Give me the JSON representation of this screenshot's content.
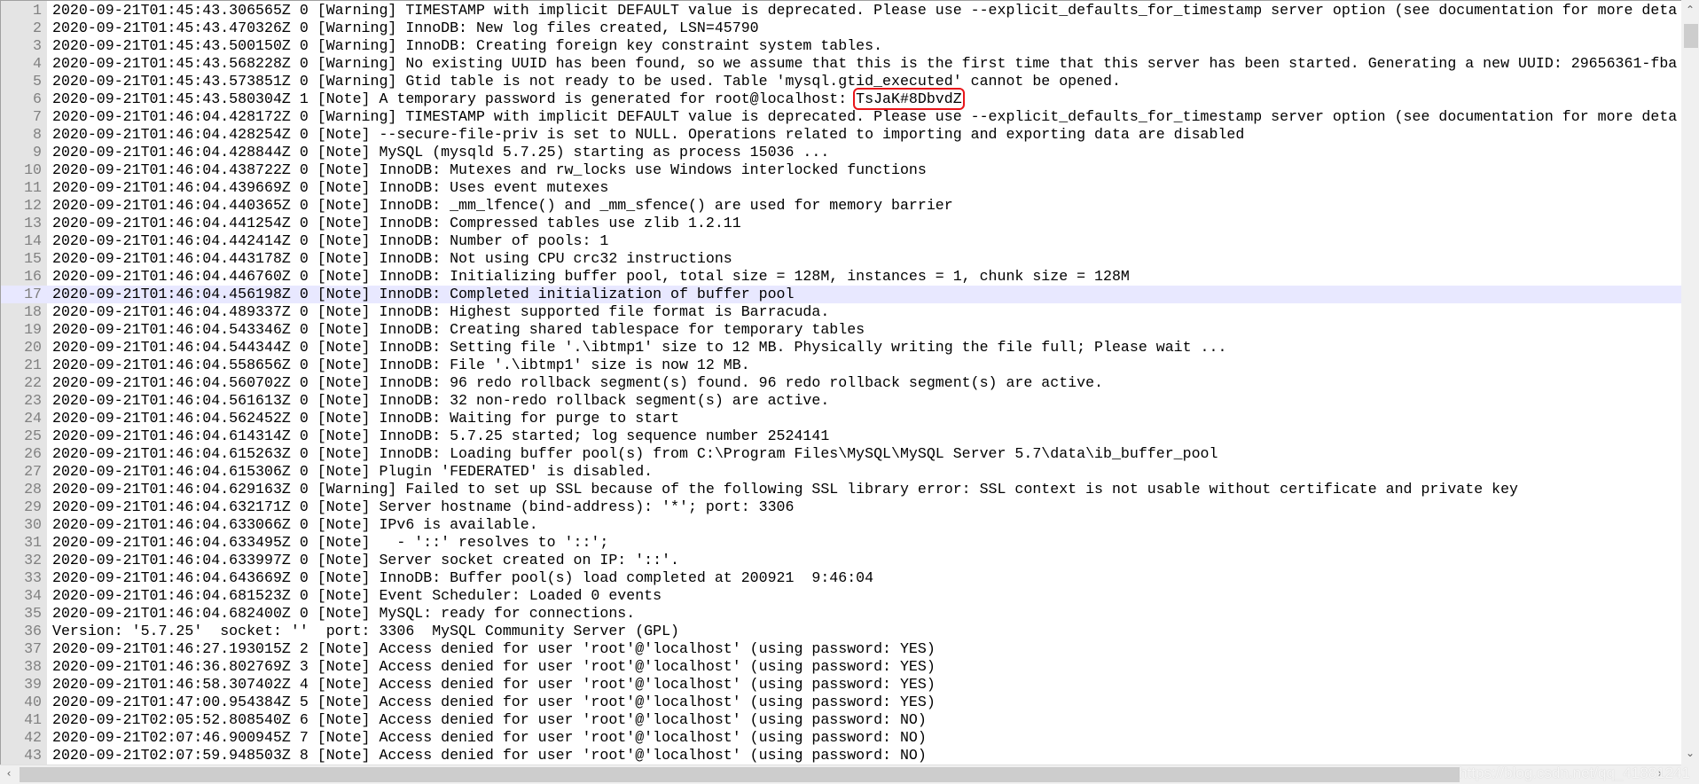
{
  "editor": {
    "current_line": 17,
    "password_line": 6,
    "password": "TsJaK#8DbvdZ",
    "highlight_color": "#e8151a",
    "lines": [
      "2020-09-21T01:45:43.306565Z 0 [Warning] TIMESTAMP with implicit DEFAULT value is deprecated. Please use --explicit_defaults_for_timestamp server option (see documentation for more deta",
      "2020-09-21T01:45:43.470326Z 0 [Warning] InnoDB: New log files created, LSN=45790",
      "2020-09-21T01:45:43.500150Z 0 [Warning] InnoDB: Creating foreign key constraint system tables.",
      "2020-09-21T01:45:43.568228Z 0 [Warning] No existing UUID has been found, so we assume that this is the first time that this server has been started. Generating a new UUID: 29656361-fba",
      "2020-09-21T01:45:43.573851Z 0 [Warning] Gtid table is not ready to be used. Table 'mysql.gtid_executed' cannot be opened.",
      "2020-09-21T01:45:43.580304Z 1 [Note] A temporary password is generated for root@localhost: ",
      "2020-09-21T01:46:04.428172Z 0 [Warning] TIMESTAMP with implicit DEFAULT value is deprecated. Please use --explicit_defaults_for_timestamp server option (see documentation for more deta",
      "2020-09-21T01:46:04.428254Z 0 [Note] --secure-file-priv is set to NULL. Operations related to importing and exporting data are disabled",
      "2020-09-21T01:46:04.428844Z 0 [Note] MySQL (mysqld 5.7.25) starting as process 15036 ...",
      "2020-09-21T01:46:04.438722Z 0 [Note] InnoDB: Mutexes and rw_locks use Windows interlocked functions",
      "2020-09-21T01:46:04.439669Z 0 [Note] InnoDB: Uses event mutexes",
      "2020-09-21T01:46:04.440365Z 0 [Note] InnoDB: _mm_lfence() and _mm_sfence() are used for memory barrier",
      "2020-09-21T01:46:04.441254Z 0 [Note] InnoDB: Compressed tables use zlib 1.2.11",
      "2020-09-21T01:46:04.442414Z 0 [Note] InnoDB: Number of pools: 1",
      "2020-09-21T01:46:04.443178Z 0 [Note] InnoDB: Not using CPU crc32 instructions",
      "2020-09-21T01:46:04.446760Z 0 [Note] InnoDB: Initializing buffer pool, total size = 128M, instances = 1, chunk size = 128M",
      "2020-09-21T01:46:04.456198Z 0 [Note] InnoDB: Completed initialization of buffer pool",
      "2020-09-21T01:46:04.489337Z 0 [Note] InnoDB: Highest supported file format is Barracuda.",
      "2020-09-21T01:46:04.543346Z 0 [Note] InnoDB: Creating shared tablespace for temporary tables",
      "2020-09-21T01:46:04.544344Z 0 [Note] InnoDB: Setting file '.\\ibtmp1' size to 12 MB. Physically writing the file full; Please wait ...",
      "2020-09-21T01:46:04.558656Z 0 [Note] InnoDB: File '.\\ibtmp1' size is now 12 MB.",
      "2020-09-21T01:46:04.560702Z 0 [Note] InnoDB: 96 redo rollback segment(s) found. 96 redo rollback segment(s) are active.",
      "2020-09-21T01:46:04.561613Z 0 [Note] InnoDB: 32 non-redo rollback segment(s) are active.",
      "2020-09-21T01:46:04.562452Z 0 [Note] InnoDB: Waiting for purge to start",
      "2020-09-21T01:46:04.614314Z 0 [Note] InnoDB: 5.7.25 started; log sequence number 2524141",
      "2020-09-21T01:46:04.615263Z 0 [Note] InnoDB: Loading buffer pool(s) from C:\\Program Files\\MySQL\\MySQL Server 5.7\\data\\ib_buffer_pool",
      "2020-09-21T01:46:04.615306Z 0 [Note] Plugin 'FEDERATED' is disabled.",
      "2020-09-21T01:46:04.629163Z 0 [Warning] Failed to set up SSL because of the following SSL library error: SSL context is not usable without certificate and private key",
      "2020-09-21T01:46:04.632171Z 0 [Note] Server hostname (bind-address): '*'; port: 3306",
      "2020-09-21T01:46:04.633066Z 0 [Note] IPv6 is available.",
      "2020-09-21T01:46:04.633495Z 0 [Note]   - '::' resolves to '::';",
      "2020-09-21T01:46:04.633997Z 0 [Note] Server socket created on IP: '::'.",
      "2020-09-21T01:46:04.643669Z 0 [Note] InnoDB: Buffer pool(s) load completed at 200921  9:46:04",
      "2020-09-21T01:46:04.681523Z 0 [Note] Event Scheduler: Loaded 0 events",
      "2020-09-21T01:46:04.682400Z 0 [Note] MySQL: ready for connections.",
      "Version: '5.7.25'  socket: ''  port: 3306  MySQL Community Server (GPL)",
      "2020-09-21T01:46:27.193015Z 2 [Note] Access denied for user 'root'@'localhost' (using password: YES)",
      "2020-09-21T01:46:36.802769Z 3 [Note] Access denied for user 'root'@'localhost' (using password: YES)",
      "2020-09-21T01:46:58.307402Z 4 [Note] Access denied for user 'root'@'localhost' (using password: YES)",
      "2020-09-21T01:47:00.954384Z 5 [Note] Access denied for user 'root'@'localhost' (using password: YES)",
      "2020-09-21T02:05:52.808540Z 6 [Note] Access denied for user 'root'@'localhost' (using password: NO)",
      "2020-09-21T02:07:46.900945Z 7 [Note] Access denied for user 'root'@'localhost' (using password: NO)",
      "2020-09-21T02:07:59.948503Z 8 [Note] Access denied for user 'root'@'localhost' (using password: NO)"
    ]
  },
  "scrollbars": {
    "up_icon": "chevron-up-icon",
    "down_icon": "chevron-down-icon",
    "left_icon": "chevron-left-icon",
    "right_icon": "chevron-right-icon"
  },
  "watermark": "https://blog.csdn.net/qq_41881241"
}
